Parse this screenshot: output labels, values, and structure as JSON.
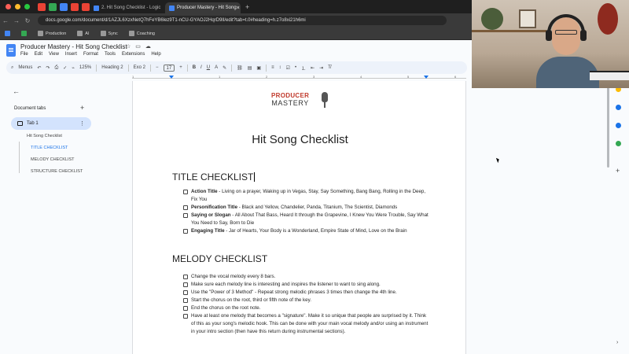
{
  "browser": {
    "tabs": [
      {
        "label": "2. Hit Song Checklist - Logic"
      },
      {
        "label": "Producer Mastery - Hit Song"
      }
    ],
    "url": "docs.google.com/document/d/1AZJL6XzxNetQ7hFeYB6lez9T1-nCU-GYAOJ2HqrD9lI/edit?tab=t.0#heading=h.z7o8xi21h6mi",
    "bookmarks": [
      "Production",
      "AI",
      "Sync",
      "Coaching"
    ]
  },
  "doc": {
    "title": "Producer Mastery - Hit Song Checklist",
    "menu": [
      "File",
      "Edit",
      "View",
      "Insert",
      "Format",
      "Tools",
      "Extensions",
      "Help"
    ]
  },
  "toolbar": {
    "menus": "Menus",
    "zoom": "125%",
    "style": "Heading 2",
    "font": "Exo 2",
    "size": "17"
  },
  "sidebar": {
    "header": "Document tabs",
    "tab": "Tab 1",
    "outline": [
      "Hit Song Checklist",
      "TITLE CHECKLIST",
      "MELODY CHECKLIST",
      "STRUCTURE CHECKLIST"
    ]
  },
  "ruler": [
    "1",
    "1",
    "2",
    "3",
    "4",
    "5",
    "6"
  ],
  "page": {
    "logo_top": "PRODUCER",
    "logo_bottom": "MASTERY",
    "title": "Hit Song Checklist",
    "section1": {
      "heading": "TITLE CHECKLIST",
      "items": [
        {
          "bold": "Action Title",
          "text": " - Living on a prayer, Waking up in Vegas, Stay, Say Something, Bang Bang, Rolling in the Deep, Fix You"
        },
        {
          "bold": "Personification Title",
          "text": " - Black and Yellow, Chandelier, Panda, Titanium, The Scientist, Diamonds"
        },
        {
          "bold": "Saying or Slogan",
          "text": " - All About That Bass, Heard It through the Grapevine, I Knew You Were Trouble, Say What You Need to Say, Born to Die"
        },
        {
          "bold": "Engaging Title",
          "text": " - Jar of Hearts, Your Body is a Wonderland, Empire State of Mind, Love on the Brain"
        }
      ]
    },
    "section2": {
      "heading": "MELODY CHECKLIST",
      "items": [
        {
          "text": "Change the vocal melody every 8 bars."
        },
        {
          "text": "Make sure each melody line is interesting and inspires the listener to want to sing along."
        },
        {
          "text": "Use the \"Power of 3 Method\" - Repeat strong melodic phrases 3 times then change the 4th line."
        },
        {
          "text": "Start the chorus on the root, third or fifth note of the key."
        },
        {
          "text": "End the chorus on the root note."
        },
        {
          "text": "Have at least one melody that becomes a \"signature\". Make it so unique that people are surprised by it. Think of this as your song's melodic hook. This can be done with your main vocal melody and/or using an instrument in your intro section (then have this return during instrumental sections)."
        }
      ]
    }
  }
}
